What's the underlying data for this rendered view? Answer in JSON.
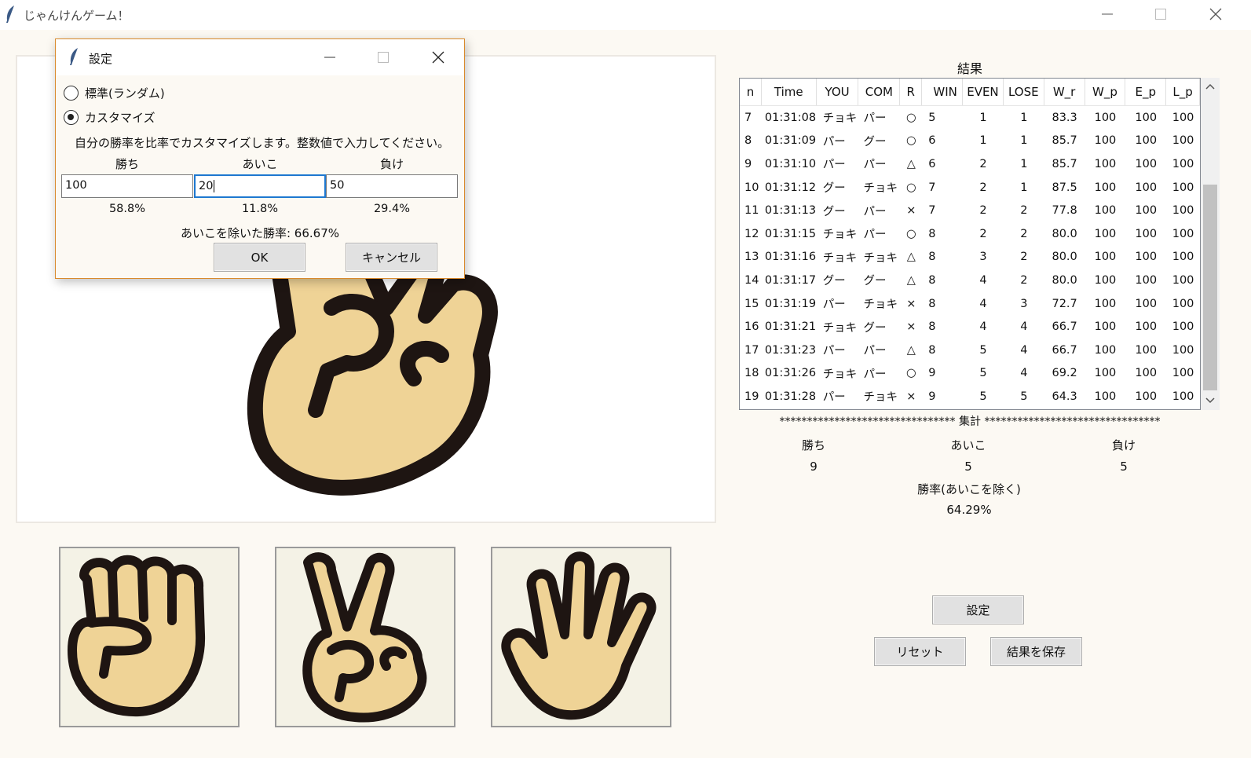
{
  "window": {
    "title": "じゃんけんゲーム！",
    "min_label": "–",
    "max_label": "□",
    "close_label": "✕"
  },
  "hands": {
    "rock": "rock-hand-icon",
    "scissors": "scissors-hand-icon",
    "paper": "paper-hand-icon"
  },
  "results": {
    "title": "結果",
    "columns": [
      "n",
      "Time",
      "YOU",
      "COM",
      "R",
      "WIN",
      "EVEN",
      "LOSE",
      "W_r",
      "W_p",
      "E_p",
      "L_p"
    ],
    "rows": [
      [
        "7",
        "01:31:08",
        "チョキ",
        "パー",
        "○",
        "5",
        "1",
        "1",
        "83.3",
        "100",
        "100",
        "100"
      ],
      [
        "8",
        "01:31:09",
        "パー",
        "グー",
        "○",
        "6",
        "1",
        "1",
        "85.7",
        "100",
        "100",
        "100"
      ],
      [
        "9",
        "01:31:10",
        "パー",
        "パー",
        "△",
        "6",
        "2",
        "1",
        "85.7",
        "100",
        "100",
        "100"
      ],
      [
        "10",
        "01:31:12",
        "グー",
        "チョキ",
        "○",
        "7",
        "2",
        "1",
        "87.5",
        "100",
        "100",
        "100"
      ],
      [
        "11",
        "01:31:13",
        "グー",
        "パー",
        "×",
        "7",
        "2",
        "2",
        "77.8",
        "100",
        "100",
        "100"
      ],
      [
        "12",
        "01:31:15",
        "チョキ",
        "パー",
        "○",
        "8",
        "2",
        "2",
        "80.0",
        "100",
        "100",
        "100"
      ],
      [
        "13",
        "01:31:16",
        "チョキ",
        "チョキ",
        "△",
        "8",
        "3",
        "2",
        "80.0",
        "100",
        "100",
        "100"
      ],
      [
        "14",
        "01:31:17",
        "グー",
        "グー",
        "△",
        "8",
        "4",
        "2",
        "80.0",
        "100",
        "100",
        "100"
      ],
      [
        "15",
        "01:31:19",
        "パー",
        "チョキ",
        "×",
        "8",
        "4",
        "3",
        "72.7",
        "100",
        "100",
        "100"
      ],
      [
        "16",
        "01:31:21",
        "チョキ",
        "グー",
        "×",
        "8",
        "4",
        "4",
        "66.7",
        "100",
        "100",
        "100"
      ],
      [
        "17",
        "01:31:23",
        "パー",
        "パー",
        "△",
        "8",
        "5",
        "4",
        "66.7",
        "100",
        "100",
        "100"
      ],
      [
        "18",
        "01:31:26",
        "チョキ",
        "パー",
        "○",
        "9",
        "5",
        "4",
        "69.2",
        "100",
        "100",
        "100"
      ],
      [
        "19",
        "01:31:28",
        "パー",
        "チョキ",
        "×",
        "9",
        "5",
        "5",
        "64.3",
        "100",
        "100",
        "100"
      ]
    ]
  },
  "summary": {
    "header": "******************************** 集計 ********************************",
    "win_label": "勝ち",
    "even_label": "あいこ",
    "lose_label": "負け",
    "win_value": "9",
    "even_value": "5",
    "lose_value": "5",
    "rate_label": "勝率(あいこを除く)",
    "rate_value": "64.29%"
  },
  "buttons": {
    "settings": "設定",
    "reset": "リセット",
    "save": "結果を保存"
  },
  "dialog": {
    "title": "設定",
    "radio_standard": "標準(ランダム)",
    "radio_custom": "カスタマイズ",
    "selected": "custom",
    "description": "自分の勝率を比率でカスタマイズします。整数値で入力してください。",
    "win_label": "勝ち",
    "even_label": "あいこ",
    "lose_label": "負け",
    "win_value": "100",
    "even_value": "20",
    "lose_value": "50",
    "win_pct": "58.8%",
    "even_pct": "11.8%",
    "lose_pct": "29.4%",
    "rate_text": "あいこを除いた勝率: 66.67%",
    "ok_label": "OK",
    "cancel_label": "キャンセル"
  }
}
